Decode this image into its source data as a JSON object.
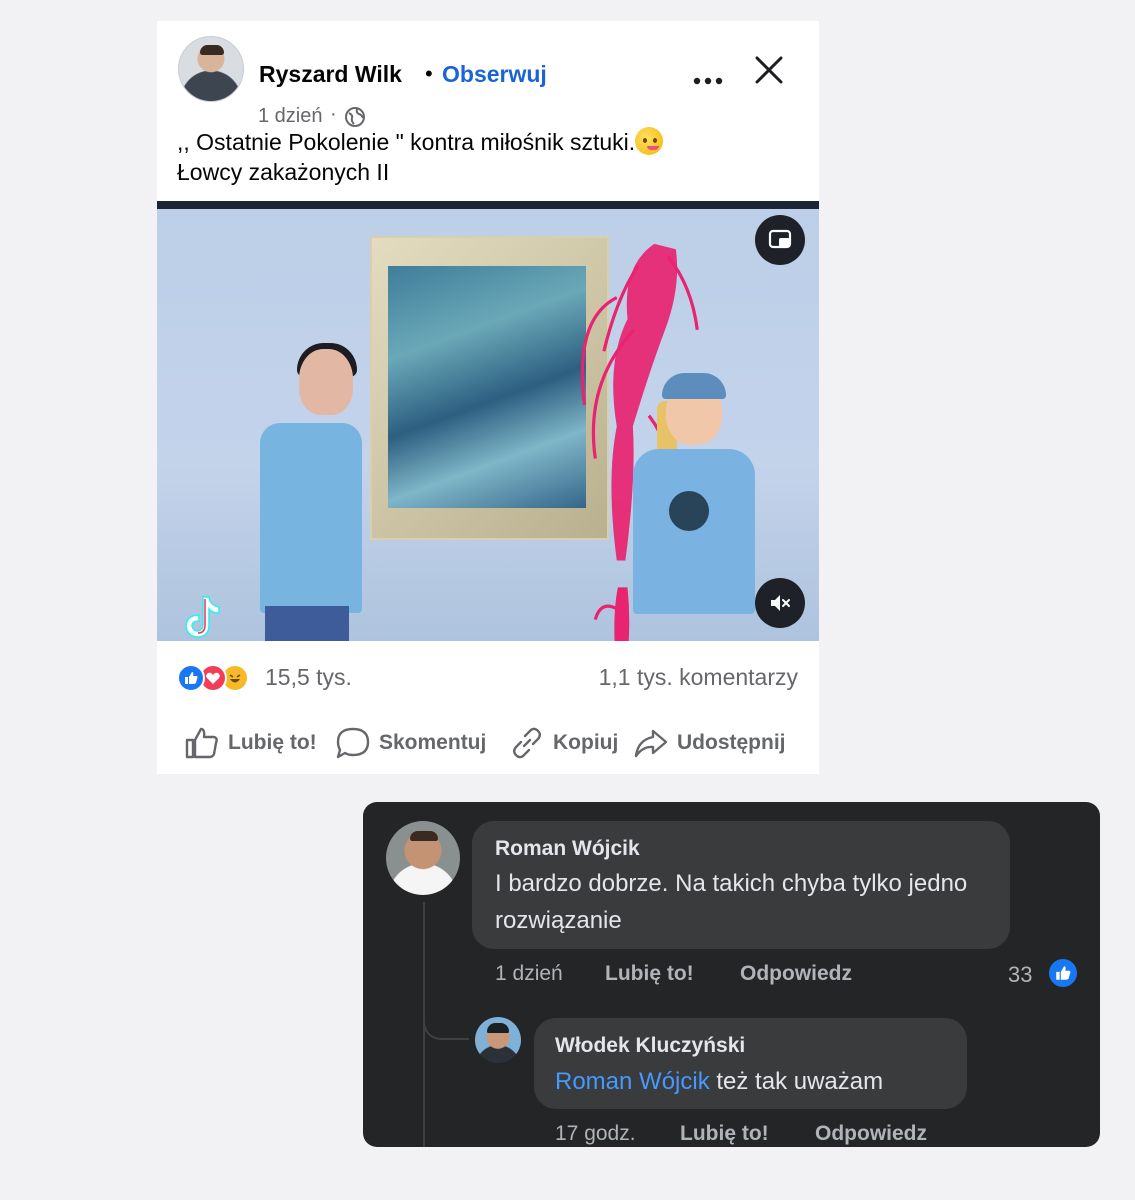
{
  "post": {
    "author": "Ryszard Wilk",
    "follow_separator": "•",
    "follow_label": "Obserwuj",
    "time": "1 dzień",
    "time_separator": "·",
    "text_line1": ",, Ostatnie Pokolenie \" kontra miłośnik sztuki.",
    "text_line2": "Łowcy zakażonych II",
    "reactions_count": "15,5 tys.",
    "comments_count": "1,1 tys. komentarzy",
    "actions": {
      "like": "Lubię to!",
      "comment": "Skomentuj",
      "copy": "Kopiuj",
      "share": "Udostępnij"
    }
  },
  "comments": [
    {
      "author": "Roman Wójcik",
      "text": "I bardzo dobrze. Na takich chyba tylko jedno rozwiązanie",
      "time": "1 dzień",
      "like_label": "Lubię to!",
      "reply_label": "Odpowiedz",
      "likes": "33"
    },
    {
      "author": "Włodek Kluczyński",
      "mention": "Roman Wójcik",
      "text": " też tak uważam",
      "time": "17 godz.",
      "like_label": "Lubię to!",
      "reply_label": "Odpowiedz"
    }
  ],
  "colors": {
    "link_blue": "#1b63d6",
    "mention_blue": "#4599ff",
    "dark_panel": "#242526",
    "bubble": "#3a3b3c"
  },
  "icons": [
    "globe-icon",
    "more-icon",
    "close-icon",
    "pip-icon",
    "mute-icon",
    "tiktok-icon",
    "like-icon",
    "comment-icon",
    "link-icon",
    "share-icon"
  ]
}
